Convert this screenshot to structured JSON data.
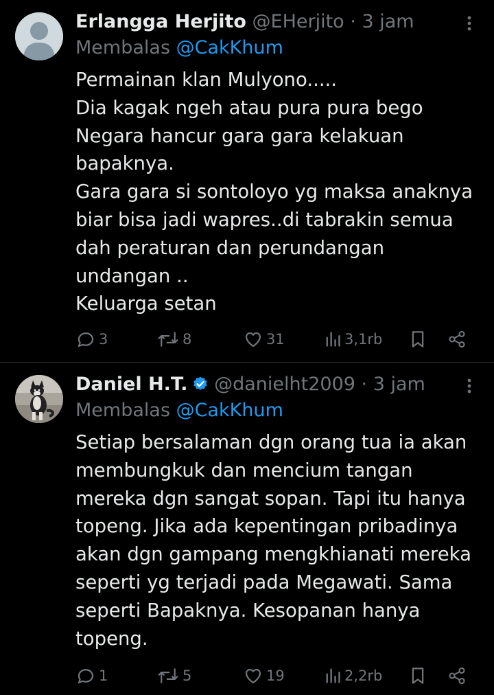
{
  "colors": {
    "background": "#000000",
    "text": "#e7e9ea",
    "muted": "#71767b",
    "link": "#1d9bf0",
    "divider": "#2f3336"
  },
  "tweets": [
    {
      "name": "Erlangga Herjito",
      "handle": "@EHerjito",
      "separator": "·",
      "time": "3 jam",
      "verified": false,
      "avatar_icon": "default-avatar-icon",
      "replying_label": "Membalas",
      "replying_to": "@CakKhum",
      "text_lines": [
        "Permainan klan Mulyono.....",
        "Dia kagak ngeh atau pura pura bego",
        "Negara hancur gara gara kelakuan",
        "bapaknya.",
        "Gara gara si sontoloyo yg maksa anaknya",
        "biar bisa jadi wapres..di tabrakin semua",
        "dah peraturan dan perundangan",
        "undangan ..",
        "Keluarga setan"
      ],
      "replies": "3",
      "reposts": "8",
      "likes": "31",
      "views": "3,1rb"
    },
    {
      "name": "Daniel H.T.",
      "handle": "@danielht2009",
      "separator": "·",
      "time": "3 jam",
      "verified": true,
      "avatar_icon": "dog-avatar-icon",
      "replying_label": "Membalas",
      "replying_to": "@CakKhum",
      "text_lines": [
        "Setiap bersalaman dgn orang tua ia akan",
        "membungkuk dan mencium tangan",
        "mereka dgn sangat sopan. Tapi itu hanya",
        "topeng. Jika ada kepentingan pribadinya",
        "akan dgn gampang mengkhianati mereka",
        "seperti yg terjadi pada Megawati. Sama",
        "seperti Bapaknya. Kesopanan hanya",
        "topeng."
      ],
      "replies": "1",
      "reposts": "5",
      "likes": "19",
      "views": "2,2rb"
    }
  ]
}
